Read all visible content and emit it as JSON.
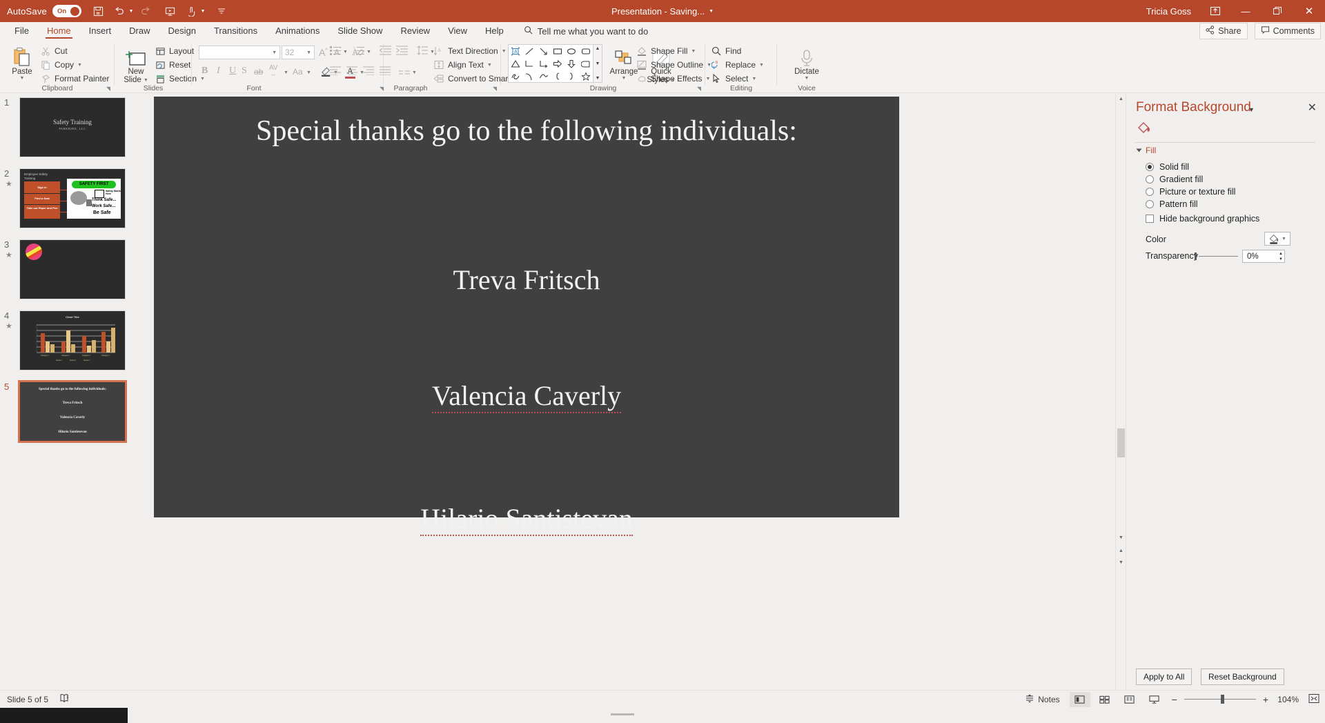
{
  "titlebar": {
    "autosave_label": "AutoSave",
    "toggle_state": "On",
    "icons": [
      "save-icon",
      "undo-icon",
      "redo-icon",
      "start-slideshow-icon",
      "touch-mode-icon",
      "customize-qat-icon"
    ],
    "document_title": "Presentation  -  Saving...",
    "user_name": "Tricia Goss",
    "ribbon_display_icon": "ribbon-display-options-icon",
    "minimize": "—",
    "restore": "❐",
    "close": "✕"
  },
  "tabs": {
    "items": [
      "File",
      "Home",
      "Insert",
      "Draw",
      "Design",
      "Transitions",
      "Animations",
      "Slide Show",
      "Review",
      "View",
      "Help"
    ],
    "active": "Home",
    "tellme_placeholder": "Tell me what you want to do",
    "share_label": "Share",
    "comments_label": "Comments"
  },
  "ribbon": {
    "groups": [
      {
        "name": "Clipboard",
        "label": "Clipboard"
      },
      {
        "name": "Slides",
        "label": "Slides"
      },
      {
        "name": "Font",
        "label": "Font"
      },
      {
        "name": "Paragraph",
        "label": "Paragraph"
      },
      {
        "name": "Drawing",
        "label": "Drawing"
      },
      {
        "name": "Editing",
        "label": "Editing"
      },
      {
        "name": "Voice",
        "label": "Voice"
      }
    ],
    "clipboard": {
      "paste_label": "Paste",
      "cut_label": "Cut",
      "copy_label": "Copy",
      "format_painter_label": "Format Painter"
    },
    "slides": {
      "new_slide_line1": "New",
      "new_slide_line2": "Slide",
      "layout_label": "Layout",
      "reset_label": "Reset",
      "section_label": "Section"
    },
    "font": {
      "font_name_value": "",
      "font_size_value": "32",
      "grow_font": "A",
      "shrink_font": "A",
      "clear_formatting": "clear-formatting-icon",
      "bold": "B",
      "italic": "I",
      "underline": "U",
      "shadow": "S",
      "strikethrough": "ab",
      "character_spacing": "AV",
      "change_case": "Aa",
      "text_highlight": "text-highlight-icon",
      "font_color": "A"
    },
    "paragraph": {
      "text_direction_label": "Text Direction",
      "align_text_label": "Align Text",
      "convert_smartart_label": "Convert to SmartArt"
    },
    "drawing": {
      "arrange_label": "Arrange",
      "quick_styles_line1": "Quick",
      "quick_styles_line2": "Styles",
      "shape_fill_label": "Shape Fill",
      "shape_outline_label": "Shape Outline",
      "shape_effects_label": "Shape Effects"
    },
    "editing": {
      "find_label": "Find",
      "replace_label": "Replace",
      "select_label": "Select"
    },
    "voice": {
      "dictate_label": "Dictate"
    }
  },
  "thumbnails": [
    {
      "number": "1",
      "has_star": false,
      "selected": false,
      "kind": "title",
      "title": "Safety Training",
      "subtitle": "PARKBIKE, LLC"
    },
    {
      "number": "2",
      "has_star": true,
      "selected": false,
      "kind": "smartart",
      "heading": "Employee Safety Training",
      "boxes": [
        "Sign In",
        "Find a Seat",
        "Take out Paper and Pen"
      ],
      "image_banner": "SAFETY FIRST",
      "image_lines": [
        "Think Safe...",
        "Work Safe...",
        "Be Safe"
      ],
      "image_tag": "Safety Starts Here"
    },
    {
      "number": "3",
      "has_star": true,
      "selected": false,
      "kind": "ball"
    },
    {
      "number": "4",
      "has_star": true,
      "selected": false,
      "kind": "chart",
      "chart_title": "Chart Title"
    },
    {
      "number": "5",
      "has_star": false,
      "selected": true,
      "kind": "thanks",
      "title": "Special thanks go to the following individuals:",
      "names": [
        "Treva Fritsch",
        "Valencia Caverly",
        "Hilario Santistevan"
      ]
    }
  ],
  "slide": {
    "title": "Special thanks go to the following individuals:",
    "names": [
      "Treva Fritsch",
      "Valencia Caverly",
      "Hilario Santistevan"
    ],
    "background_color": "#404040",
    "text_color": "#f2f2f2"
  },
  "format_background": {
    "pane_title": "Format Background",
    "fill_section_label": "Fill",
    "options": [
      {
        "label": "Solid fill",
        "selected": true
      },
      {
        "label": "Gradient fill",
        "selected": false
      },
      {
        "label": "Picture or texture fill",
        "selected": false
      },
      {
        "label": "Pattern fill",
        "selected": false
      }
    ],
    "hide_bg_label": "Hide background graphics",
    "hide_bg_checked": false,
    "color_label": "Color",
    "transparency_label": "Transparency",
    "transparency_value": "0%",
    "apply_to_all_label": "Apply to All",
    "reset_background_label": "Reset Background",
    "accent_color": "#b7472a"
  },
  "statusbar": {
    "slide_indicator": "Slide 5 of 5",
    "accessibility_icon": "accessibility-checker-icon",
    "notes_label": "Notes",
    "views": [
      "normal-view-icon",
      "slide-sorter-icon",
      "reading-view-icon",
      "slideshow-view-icon"
    ],
    "active_view": "normal-view-icon",
    "zoom_minus": "−",
    "zoom_plus": "+",
    "zoom_level": "104%",
    "fit_slide_icon": "fit-slide-to-window-icon"
  }
}
